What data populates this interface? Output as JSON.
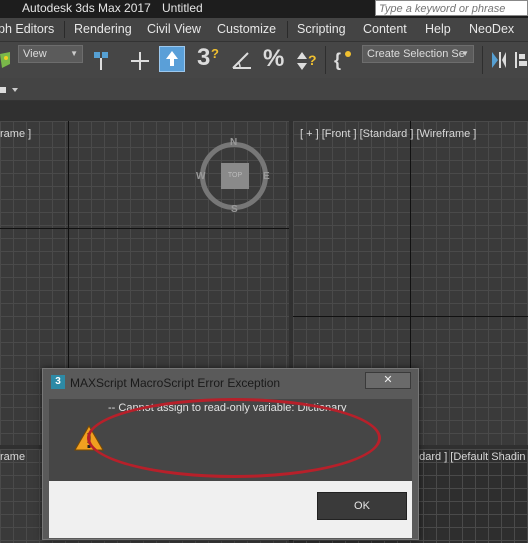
{
  "titlebar": {
    "app": "Autodesk 3ds Max 2017",
    "doc": "Untitled",
    "search_placeholder": "Type a keyword or phrase"
  },
  "menu": [
    "ph Editors",
    "Rendering",
    "Civil View",
    "Customize",
    "Scripting",
    "Content",
    "Help",
    "NeoDex"
  ],
  "toolbar": {
    "view_dropdown": "View",
    "selection_set": "Create Selection Se",
    "snaps_label": "3",
    "percent_label": "%"
  },
  "viewports": {
    "top_left_label": "rame ]",
    "top_right_label": "[ + ] [Front ] [Standard ] [Wireframe ]",
    "bottom_left_label": "rame",
    "bottom_right_label": "ndard ] [Default Shadin"
  },
  "viewcube": {
    "face": "TOP",
    "n": "N",
    "s": "S",
    "e": "E",
    "w": "W"
  },
  "dialog": {
    "title": "MAXScript MacroScript Error Exception",
    "icon": "3",
    "close": "✕",
    "message": "-- Cannot assign to read-only variable: Dictionary",
    "ok": "OK"
  },
  "colors": {
    "highlight_ellipse": "#b7202a",
    "warning": "#f0a020"
  }
}
